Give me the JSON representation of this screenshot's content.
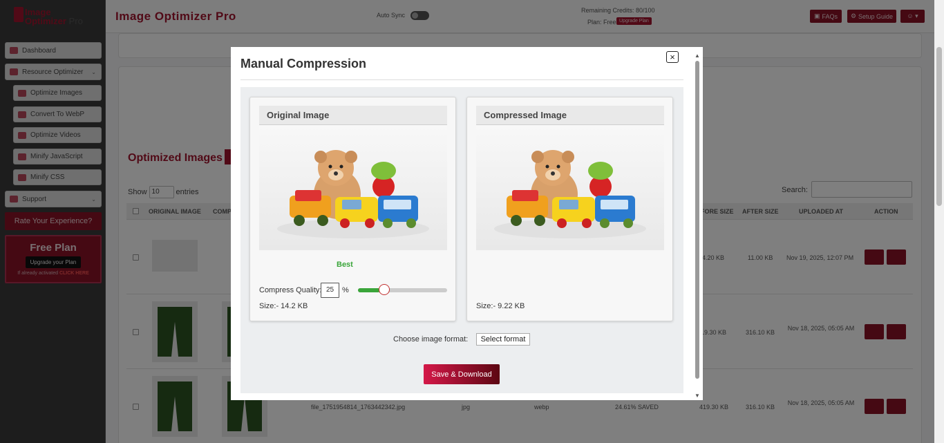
{
  "app": {
    "title": "Image Optimizer Pro",
    "logo_line1": "Image",
    "logo_line2a": "Optimizer",
    "logo_line2b": "Pro",
    "auto_sync": "Auto Sync",
    "credits": "Remaining Credits: 80/100",
    "plan": "Plan: Free",
    "upgrade_plan": "Upgrade Plan",
    "faqs": "FAQs",
    "setup_guide": "Setup Guide"
  },
  "sidebar": {
    "items": [
      {
        "label": "Dashboard"
      },
      {
        "label": "Resource Optimizer"
      },
      {
        "label": "Optimize Images"
      },
      {
        "label": "Convert To WebP"
      },
      {
        "label": "Optimize Videos"
      },
      {
        "label": "Minify JavaScript"
      },
      {
        "label": "Minify CSS"
      },
      {
        "label": "Support"
      }
    ],
    "rate": "Rate Your Experience?",
    "free_plan": "Free Plan",
    "upgrade_btn": "Upgrade your Plan",
    "activated": "If already activated",
    "click_here": "CLICK HERE"
  },
  "table": {
    "title": "Optimized Images",
    "show": "Show",
    "entries_value": "10",
    "entries": "entries",
    "search": "Search:",
    "headers": {
      "original": "ORIGINAL IMAGE",
      "comp": "COMP",
      "before": "FORE SIZE",
      "after": "AFTER SIZE",
      "uploaded": "UPLOADED AT",
      "action": "ACTION"
    },
    "rows": [
      {
        "before": "4.20 KB",
        "after": "11.00 KB",
        "uploaded": "Nov 19, 2025, 12:07 PM"
      },
      {
        "before": "19.30 KB",
        "after": "316.10 KB",
        "uploaded": "Nov 18, 2025, 05:05 AM"
      },
      {
        "filename": "file_1751954814_1763442342.jpg",
        "ext": "jpg",
        "format": "webp",
        "saved": "24.61% SAVED",
        "before": "419.30 KB",
        "after": "316.10 KB",
        "uploaded": "Nov 18, 2025, 05:05 AM"
      }
    ]
  },
  "modal": {
    "title": "Manual Compression",
    "original_title": "Original Image",
    "compressed_title": "Compressed Image",
    "best": "Best",
    "compress_quality_label": "Compress Quality:",
    "compress_quality_value": "25",
    "percent": "%",
    "quality_fraction": 0.25,
    "original_size": "Size:- 14.2 KB",
    "compressed_size": "Size:- 9.22 KB",
    "format_label": "Choose image format:",
    "format_value": "Select format",
    "save_button": "Save & Download",
    "close_glyph": "×"
  },
  "icons": [
    "dashboard-icon",
    "list-icon",
    "image-icon",
    "close-icon",
    "download-icon",
    "sliders-icon"
  ],
  "colors": {
    "brand": "#a3152e",
    "success": "#3aa53a"
  }
}
